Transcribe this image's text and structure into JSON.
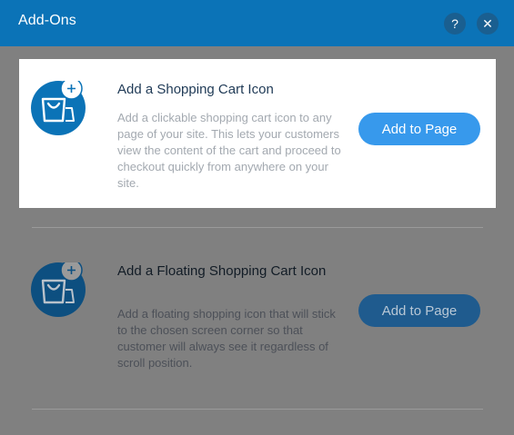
{
  "header": {
    "title": "Add-Ons",
    "help_glyph": "?",
    "close_glyph": "✕"
  },
  "addons": [
    {
      "title": "Add a Shopping Cart Icon",
      "description": "Add a clickable shopping cart icon to any page of your site. This lets your customers view the content of the cart and proceed to checkout quickly from anywhere on your site.",
      "button_label": "Add to Page",
      "icon": "shopping-bag-icon",
      "selected": true
    },
    {
      "title": "Add a Floating Shopping Cart Icon",
      "description": "Add a floating shopping icon that will stick to the chosen screen corner so that customer will always see it regardless of scroll position.",
      "button_label": "Add to Page",
      "icon": "shopping-bag-icon",
      "selected": false
    }
  ],
  "colors": {
    "header": "#0b73b7",
    "button": "#3799ec",
    "icon_circle": "#0b73b7",
    "overlay": "#808080"
  }
}
